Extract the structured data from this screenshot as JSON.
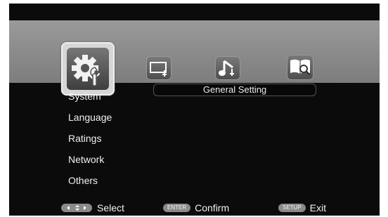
{
  "tabs": [
    {
      "name": "General Setting",
      "icon": "gear-wrench-icon",
      "selected": true
    },
    {
      "name": "Video",
      "icon": "monitor-icon",
      "selected": false
    },
    {
      "name": "Audio",
      "icon": "music-note-icon",
      "selected": false
    },
    {
      "name": "Search",
      "icon": "book-search-icon",
      "selected": false
    }
  ],
  "header": {
    "title": "General Setting"
  },
  "menu": {
    "items": [
      {
        "label": "System"
      },
      {
        "label": "Language"
      },
      {
        "label": "Ratings"
      },
      {
        "label": "Network"
      },
      {
        "label": "Others"
      }
    ]
  },
  "footer": {
    "select": {
      "key": "arrow-keys",
      "label": "Select"
    },
    "confirm": {
      "key": "ENTER",
      "label": "Confirm"
    },
    "exit": {
      "key": "SETUP",
      "label": "Exit"
    }
  },
  "colors": {
    "background": "#0b0b0b",
    "band": "#8c8c8c",
    "text": "#f0f0f0",
    "keycap": "#8a8a8a"
  }
}
